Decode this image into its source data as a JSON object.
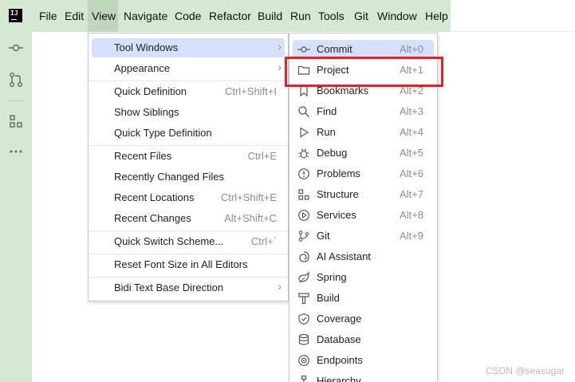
{
  "app": {
    "logo_text": "IJ"
  },
  "menubar": {
    "items": [
      "File",
      "Edit",
      "View",
      "Navigate",
      "Code",
      "Refactor",
      "Build",
      "Run",
      "Tools",
      "Git",
      "Window",
      "Help"
    ],
    "active": "View"
  },
  "view_menu": {
    "items": [
      {
        "label": "Tool Windows",
        "shortcut": "",
        "submenu": true,
        "selected": true
      },
      {
        "label": "Appearance",
        "shortcut": "",
        "submenu": true
      },
      {
        "label": "Quick Definition",
        "shortcut": "Ctrl+Shift+I"
      },
      {
        "label": "Show Siblings",
        "shortcut": ""
      },
      {
        "label": "Quick Type Definition",
        "shortcut": ""
      },
      {
        "label": "Recent Files",
        "shortcut": "Ctrl+E"
      },
      {
        "label": "Recently Changed Files",
        "shortcut": ""
      },
      {
        "label": "Recent Locations",
        "shortcut": "Ctrl+Shift+E"
      },
      {
        "label": "Recent Changes",
        "shortcut": "Alt+Shift+C"
      },
      {
        "label": "Quick Switch Scheme...",
        "shortcut": "Ctrl+`"
      },
      {
        "label": "Reset Font Size in All Editors",
        "shortcut": ""
      },
      {
        "label": "Bidi Text Base Direction",
        "shortcut": "",
        "submenu": true
      }
    ]
  },
  "tool_windows_menu": {
    "items": [
      {
        "label": "Commit",
        "shortcut": "Alt+0",
        "icon": "commit-icon",
        "selected": true
      },
      {
        "label": "Project",
        "shortcut": "Alt+1",
        "icon": "folder-icon",
        "highlighted": true
      },
      {
        "label": "Bookmarks",
        "shortcut": "Alt+2",
        "icon": "bookmark-icon"
      },
      {
        "label": "Find",
        "shortcut": "Alt+3",
        "icon": "search-icon"
      },
      {
        "label": "Run",
        "shortcut": "Alt+4",
        "icon": "run-icon"
      },
      {
        "label": "Debug",
        "shortcut": "Alt+5",
        "icon": "bug-icon"
      },
      {
        "label": "Problems",
        "shortcut": "Alt+6",
        "icon": "problems-icon"
      },
      {
        "label": "Structure",
        "shortcut": "Alt+7",
        "icon": "structure-icon"
      },
      {
        "label": "Services",
        "shortcut": "Alt+8",
        "icon": "services-icon"
      },
      {
        "label": "Git",
        "shortcut": "Alt+9",
        "icon": "git-icon"
      },
      {
        "label": "AI Assistant",
        "shortcut": "",
        "icon": "ai-assistant-icon"
      },
      {
        "label": "Spring",
        "shortcut": "",
        "icon": "spring-icon"
      },
      {
        "label": "Build",
        "shortcut": "",
        "icon": "hammer-icon"
      },
      {
        "label": "Coverage",
        "shortcut": "",
        "icon": "shield-icon"
      },
      {
        "label": "Database",
        "shortcut": "",
        "icon": "database-icon"
      },
      {
        "label": "Endpoints",
        "shortcut": "",
        "icon": "endpoints-icon"
      },
      {
        "label": "Hierarchy",
        "shortcut": "",
        "icon": "hierarchy-icon"
      }
    ]
  },
  "watermark": "CSDN @seasugar",
  "colors": {
    "menubar_bg": "#d4e8d2",
    "selection": "#d5e1fb",
    "highlight_box": "#e8202a"
  }
}
